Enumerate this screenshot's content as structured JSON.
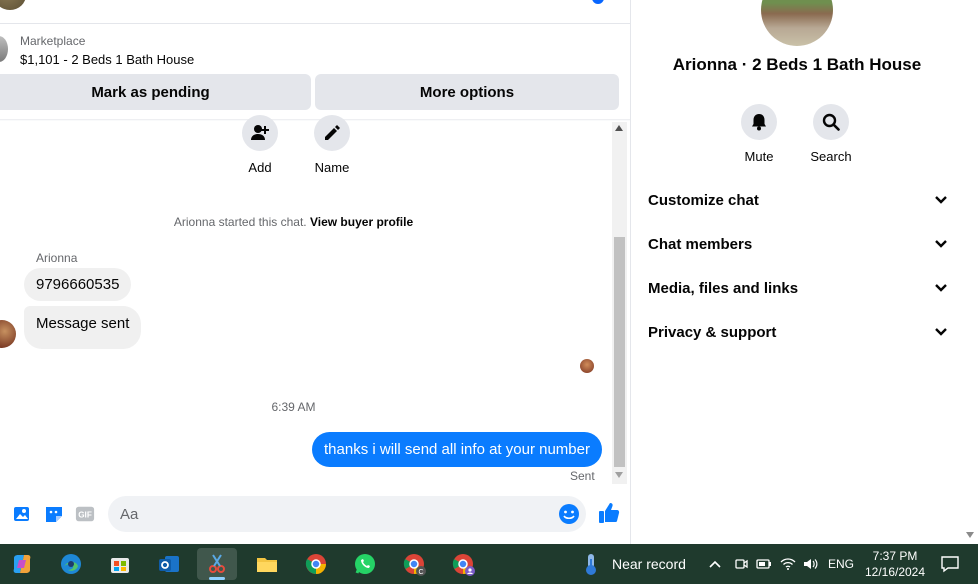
{
  "listing": {
    "source": "Marketplace",
    "title": "$1,101 - 2 Beds 1 Bath House"
  },
  "actions": {
    "mark_pending": "Mark as pending",
    "more_options": "More options"
  },
  "quick_actions": {
    "add": "Add",
    "name": "Name"
  },
  "conversation": {
    "started_text": "Arionna started this chat.",
    "view_profile": "View buyer profile",
    "sender": "Arionna",
    "incoming": [
      "9796660535",
      "Message sent"
    ],
    "timestamp": "6:39 AM",
    "outgoing": "thanks i will send all info at your number",
    "status": "Sent"
  },
  "composer": {
    "placeholder": "Aa"
  },
  "info": {
    "title": "Arionna · 2 Beds 1 Bath House",
    "mute": "Mute",
    "search": "Search",
    "sections": [
      "Customize chat",
      "Chat members",
      "Media, files and links",
      "Privacy & support"
    ]
  },
  "taskbar": {
    "apps": [
      "copilot-icon",
      "edge-icon",
      "store-icon",
      "outlook-icon",
      "snipping-tool-icon",
      "file-explorer-icon",
      "chrome-icon",
      "whatsapp-icon",
      "chrome-profile-c-icon",
      "chrome-profile-icon"
    ],
    "weather": "Near record",
    "language": "ENG",
    "time": "7:37 PM",
    "date": "12/16/2024"
  },
  "colors": {
    "accent": "#0a7cff",
    "bubble_in": "#f0f0f0",
    "button_bg": "#e4e6eb",
    "taskbar": "#1f3a2d"
  }
}
